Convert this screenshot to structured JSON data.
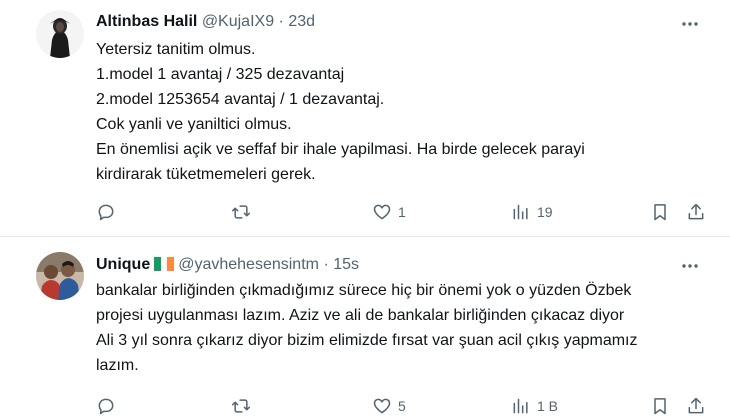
{
  "tweets": [
    {
      "author_name": "Altinbas Halil",
      "handle": "@KujaIX9",
      "separator": "·",
      "time": "23d",
      "lines": [
        "Yetersiz tanitim olmus.",
        "1.model 1 avantaj / 325 dezavantaj",
        "2.model 1253654 avantaj / 1 dezavantaj.",
        "Cok yanli ve yaniltici olmus.",
        "En önemlisi açik ve seffaf bir ihale yapilmasi. Ha birde gelecek parayi",
        "kirdirarak tüketmemeleri gerek."
      ],
      "stats": {
        "replies": "",
        "retweets": "",
        "likes": "1",
        "views": "19"
      }
    },
    {
      "author_name": "Unique",
      "handle": "@yavhehesensintm",
      "separator": "·",
      "time": "15s",
      "flag": "ireland-flag-icon",
      "lines": [
        "bankalar birliğinden çıkmadığımız sürece hiç bir önemi yok o yüzden Özbek",
        "projesi uygulanması lazım. Aziz ve ali de bankalar birliğinden çıkacaz diyor",
        "Ali 3 yıl sonra çıkarız diyor bizim elimizde fırsat var şuan acil çıkış yapmamız",
        "lazım."
      ],
      "stats": {
        "replies": "",
        "retweets": "",
        "likes": "5",
        "views": "1 B"
      }
    }
  ],
  "colors": {
    "text": "#0f1419",
    "muted": "#536471",
    "divider": "#e6e9ec"
  },
  "icons": [
    "avatar",
    "more-icon",
    "reply-icon",
    "retweet-icon",
    "like-icon",
    "views-icon",
    "bookmark-icon",
    "share-icon"
  ]
}
